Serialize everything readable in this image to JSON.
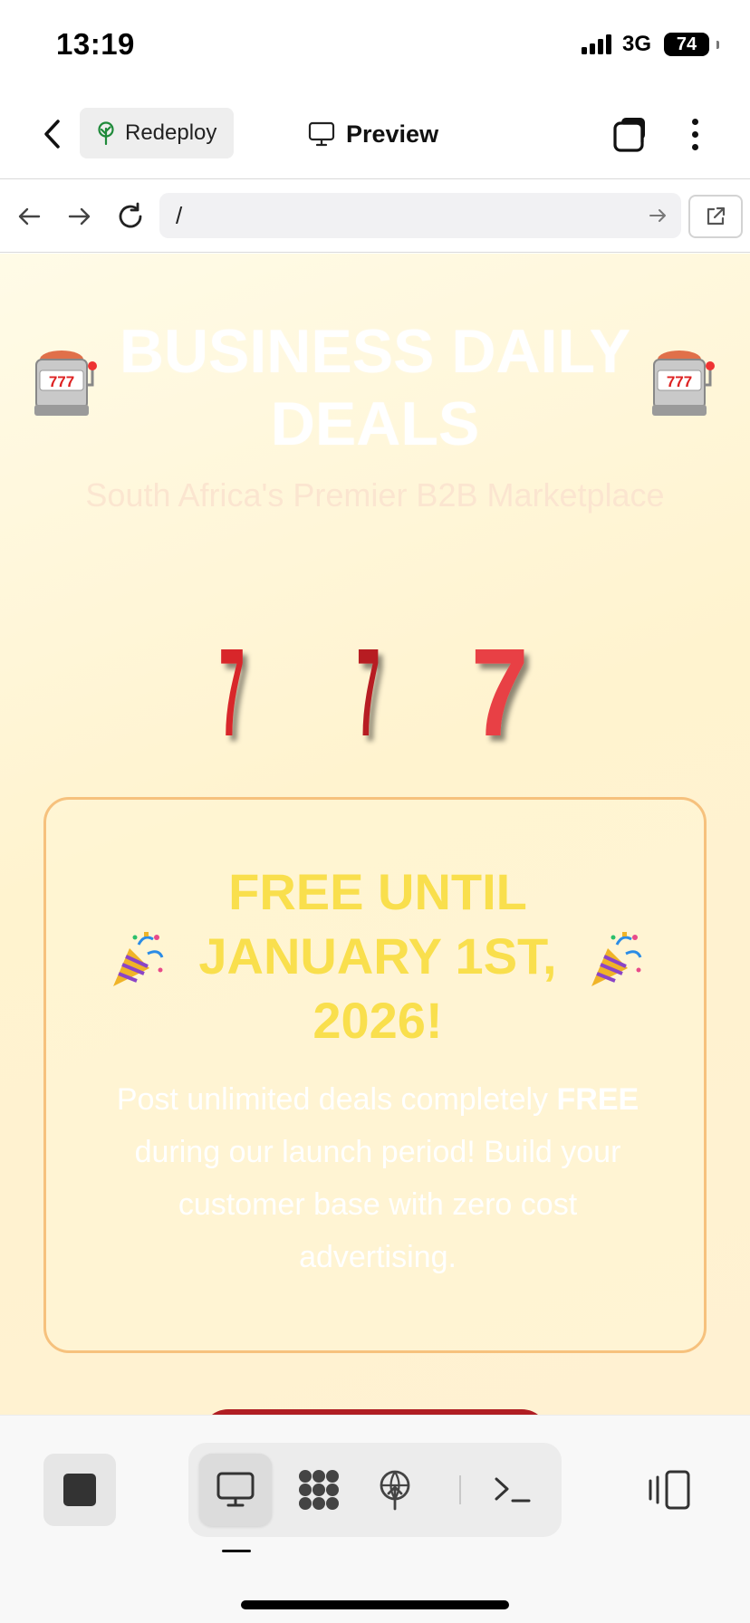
{
  "status_bar": {
    "time": "13:19",
    "network": "3G",
    "battery": "74"
  },
  "header": {
    "redeploy_label": "Redeploy",
    "preview_label": "Preview"
  },
  "browser": {
    "url": "/"
  },
  "page": {
    "title": "BUSINESS DAILY DEALS",
    "subtitle": "South Africa's Premier B2B Marketplace",
    "slot_digits": [
      "7",
      "7",
      "7"
    ],
    "promo": {
      "heading": "FREE UNTIL JANUARY 1ST, 2026!",
      "body_prefix": "Post unlimited deals completely",
      "body_bold": "FREE",
      "body_suffix": "during our launch period! Build your customer base with zero cost advertising."
    }
  },
  "toolbar": {
    "items": [
      "stop",
      "preview",
      "components",
      "deploy",
      "terminal",
      "panel"
    ]
  },
  "icons": {
    "back": "chevron-left-icon",
    "redeploy": "deploy-tree-icon",
    "preview": "monitor-icon",
    "tabs": "tabs-icon",
    "more": "more-vertical-icon",
    "nav_back": "arrow-left-icon",
    "nav_forward": "arrow-right-icon",
    "reload": "reload-icon",
    "go": "arrow-right-icon",
    "external": "external-link-icon",
    "slot": "slot-machine-icon",
    "party": "party-popper-icon"
  },
  "colors": {
    "title": "#ffffff",
    "promo_heading": "#f9df4d",
    "card_border": "#f6c17d",
    "seven_red": "#d8262a",
    "cta": "#b01e23"
  }
}
